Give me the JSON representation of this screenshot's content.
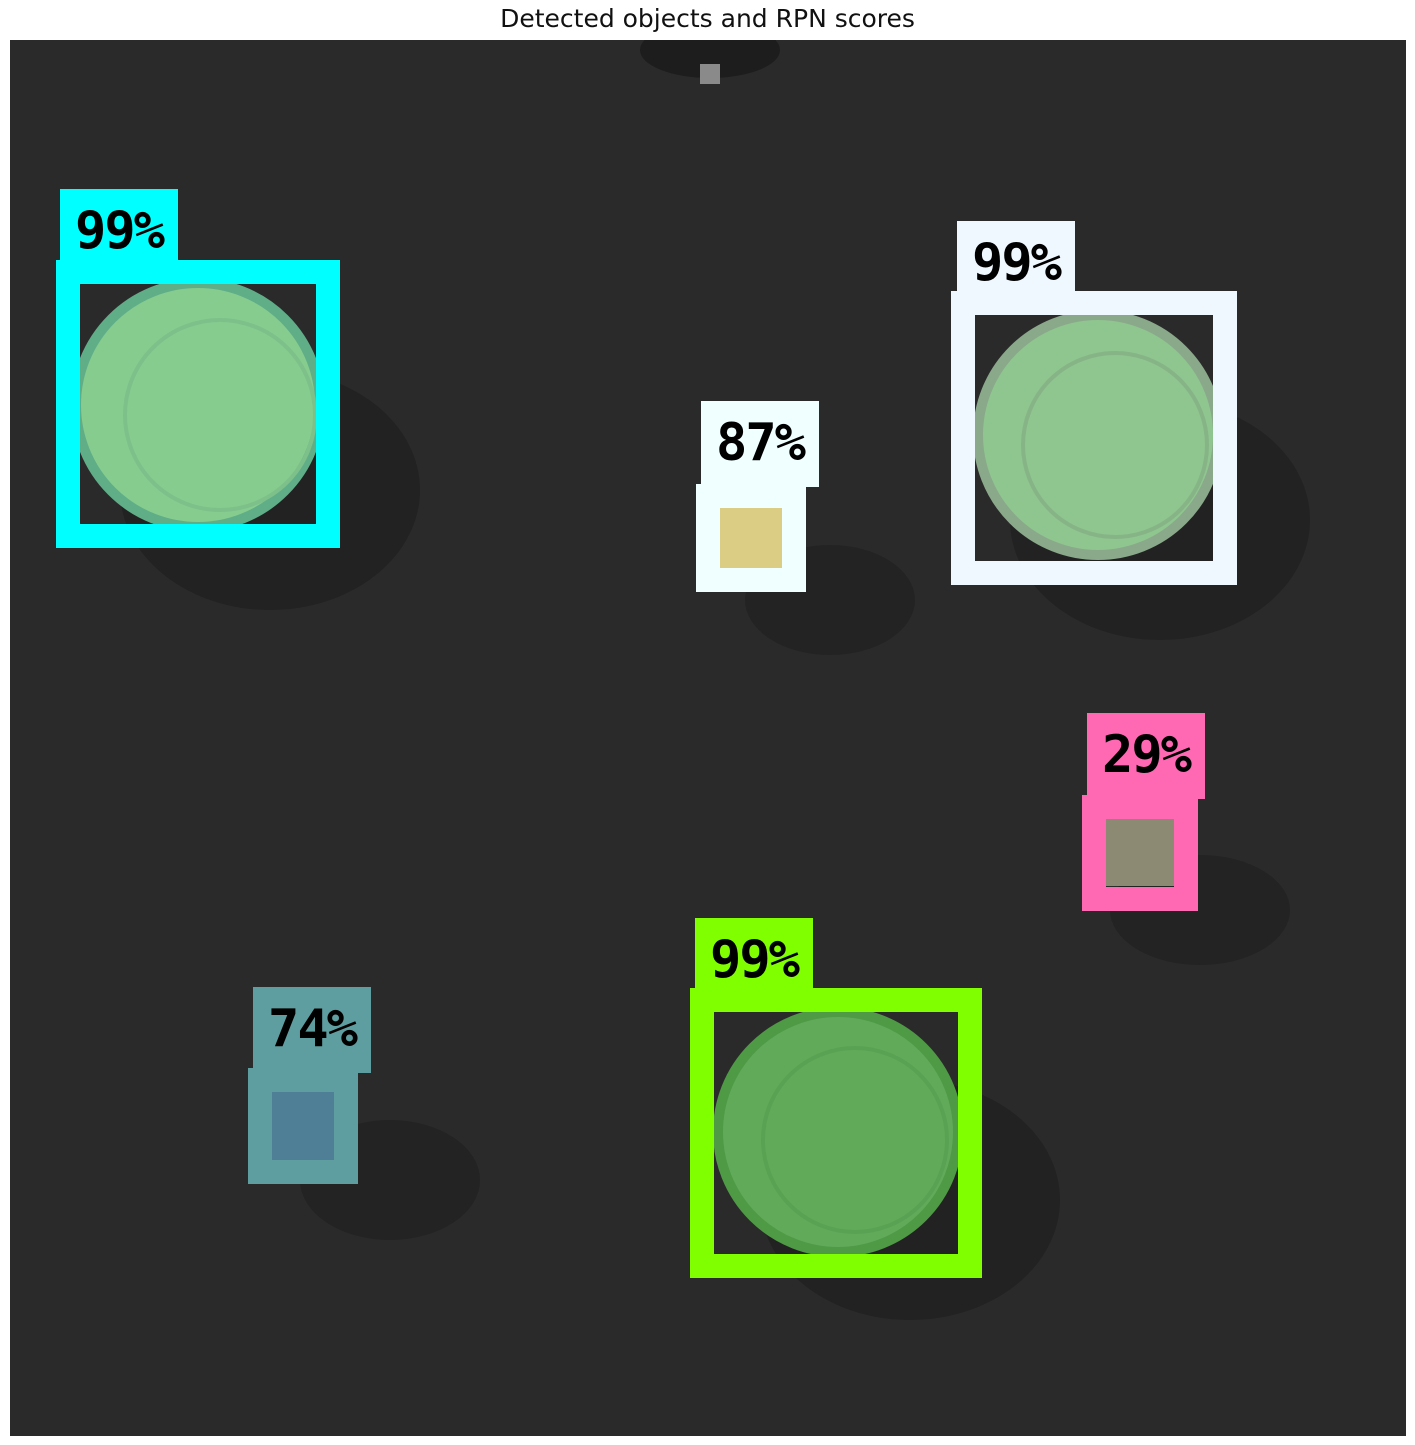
{
  "title": "Detected objects and RPN scores",
  "background_color": "#2a2a2a",
  "detections": [
    {
      "score_label": "99%",
      "color": "#00ffff",
      "object": "plate",
      "fill": "#86cc8e"
    },
    {
      "score_label": "87%",
      "color": "#f0ffff",
      "object": "block",
      "fill": "#dccd85"
    },
    {
      "score_label": "99%",
      "color": "#f0f8ff",
      "object": "plate",
      "fill": "#8fc58f"
    },
    {
      "score_label": "29%",
      "color": "#ff69b4",
      "object": "block",
      "fill": "#8c8a73"
    },
    {
      "score_label": "99%",
      "color": "#7fff00",
      "object": "plate",
      "fill": "#60aa5a"
    },
    {
      "score_label": "74%",
      "color": "#5f9ea0",
      "object": "block",
      "fill": "#4f7f96"
    }
  ]
}
